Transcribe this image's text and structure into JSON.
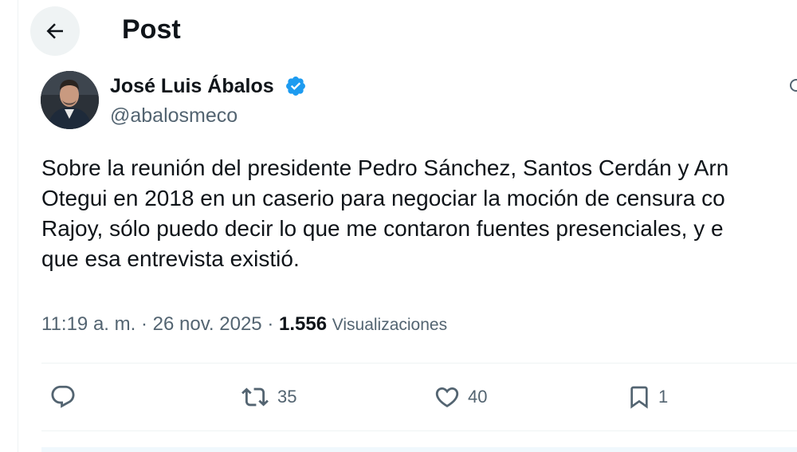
{
  "header": {
    "title": "Post",
    "back_icon": "arrow-left-icon"
  },
  "tweet": {
    "author_name": "José Luis Ábalos",
    "handle": "@abalosmeco",
    "verified": true,
    "verified_color": "#1d9bf0",
    "text_lines": [
      "Sobre la reunión del presidente Pedro Sánchez, Santos Cerdán y Arn",
      "Otegui en 2018 en un caserio para negociar la moción de censura co",
      "Rajoy, sólo puedo decir lo que me contaron fuentes presenciales, y e",
      "que esa entrevista existió."
    ],
    "time": "11:19 a. m.",
    "separator": "·",
    "date": "26 nov. 2025",
    "views_count": "1.556",
    "views_label": "Visualizaciones"
  },
  "actions": {
    "reply": {
      "icon": "reply-icon",
      "count": ""
    },
    "repost": {
      "icon": "repost-icon",
      "count": "35"
    },
    "like": {
      "icon": "heart-icon",
      "count": "40"
    },
    "bookmark": {
      "icon": "bookmark-icon",
      "count": "1"
    }
  },
  "colors": {
    "text": "#0f1419",
    "muted": "#536471",
    "divider": "#eff3f4",
    "accent": "#1d9bf0"
  }
}
